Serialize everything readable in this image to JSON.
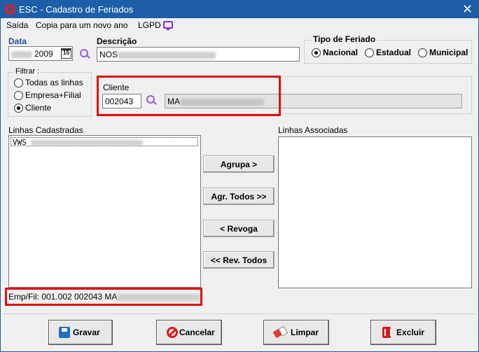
{
  "window": {
    "title": "ESC - Cadastro de Feriados",
    "close_glyph": "✕"
  },
  "menu": {
    "items": [
      "Saída",
      "Copia para um novo ano",
      "LGPD"
    ]
  },
  "data_field": {
    "label": "Data",
    "value_year": "2009",
    "calendar_day": "15"
  },
  "descricao": {
    "label": "Descrição",
    "value_prefix": "NOS"
  },
  "tipo_feriado": {
    "title": "Tipo de Feriado",
    "options": [
      "Nacional",
      "Estadual",
      "Municipal"
    ],
    "selected": "Nacional"
  },
  "filtrar": {
    "title": "Filtrar :",
    "options": [
      "Todas as linhas",
      "Empresa+Filial",
      "Cliente"
    ],
    "selected": "Cliente"
  },
  "cliente": {
    "label": "Cliente",
    "code": "002043",
    "name_prefix": "MA"
  },
  "linhas_cadastradas": {
    "label": "Linhas Cadastradas",
    "items": [
      "VWS"
    ]
  },
  "linhas_associadas": {
    "label": "Linhas Associadas",
    "items": []
  },
  "transfer_buttons": {
    "agrupa": "Agrupa >",
    "agr_todos": "Agr. Todos >>",
    "revoga": "< Revoga",
    "rev_todos": "<< Rev. Todos"
  },
  "status": {
    "text": "Emp/Fil: 001.002 002043 MA"
  },
  "actions": {
    "gravar": "Gravar",
    "cancelar": "Cancelar",
    "limpar": "Limpar",
    "excluir": "Excluir"
  },
  "colors": {
    "title_bar": "#1c5fa8",
    "highlight_border": "#e01010",
    "accent_purple": "#8a2be2"
  }
}
